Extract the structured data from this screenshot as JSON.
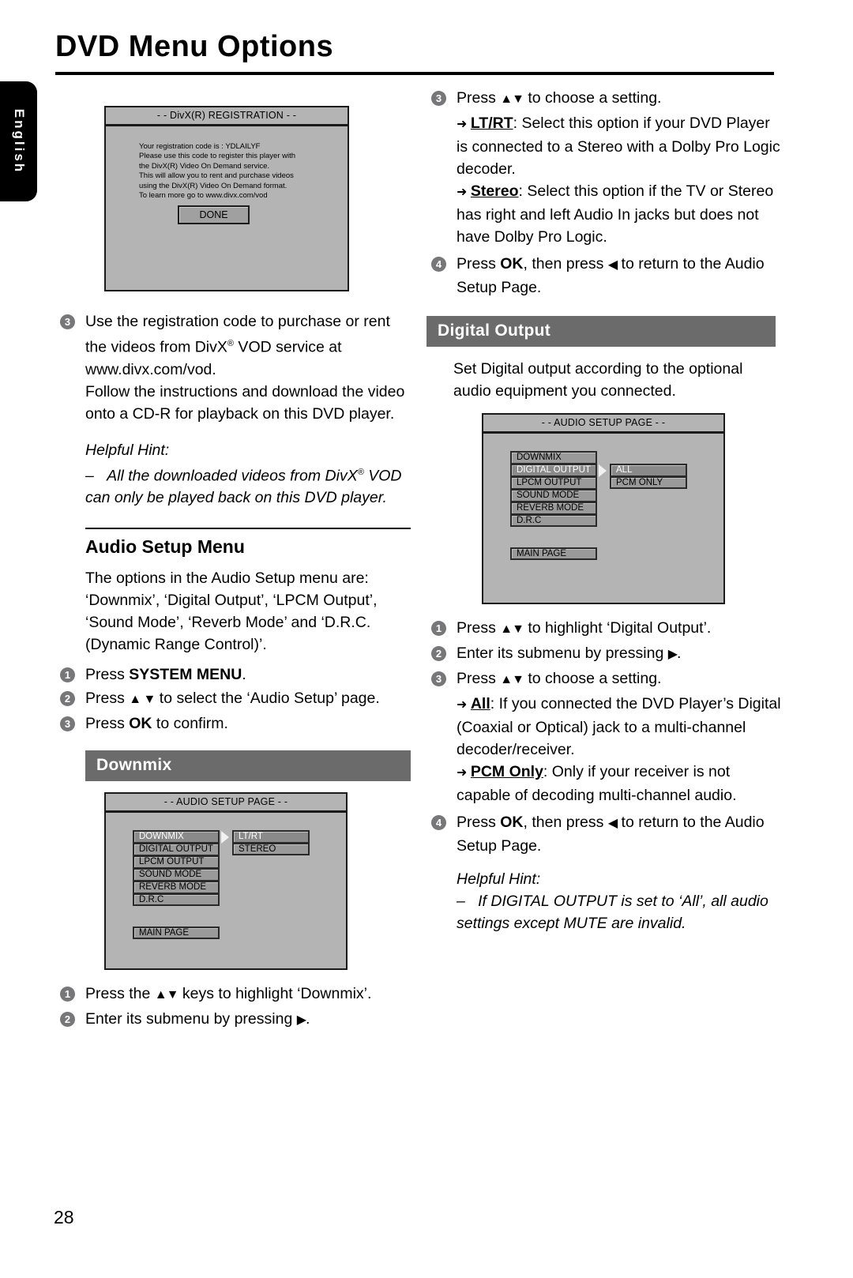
{
  "document": {
    "title": "DVD Menu Options",
    "page_number": "28",
    "language_tab": "English"
  },
  "left_column": {
    "divx_screen": {
      "title": "- - DivX(R) REGISTRATION - -",
      "lines": [
        "Your registration code is : YDLAILYF",
        "Please use this code to register this player with",
        "the DivX(R) Video On Demand service.",
        "This will allow you to rent and purchase videos",
        "using the DivX(R) Video On Demand format.",
        "To learn more go to www.divx.com/vod"
      ],
      "button": "DONE"
    },
    "step3": {
      "num": "3",
      "text_a": "Use the registration code to purchase or rent the videos from DivX",
      "reg": "®",
      "text_b": " VOD service at www.divx.com/vod.",
      "text_c": "Follow the instructions and download the video onto a CD-R for playback on this DVD player."
    },
    "hint": {
      "label": "Helpful Hint:",
      "dash": "–",
      "text_a": "All the downloaded videos from DivX",
      "reg": "®",
      "text_b": " VOD can only be played back on this DVD player."
    },
    "audio_setup_menu": {
      "heading": "Audio Setup Menu",
      "intro": "The options in the Audio Setup menu are: ‘Downmix’, ‘Digital Output’, ‘LPCM Output’, ‘Sound Mode’, ‘Reverb Mode’ and ‘D.R.C. (Dynamic Range Control)’.",
      "steps": [
        {
          "num": "1",
          "pre": "Press ",
          "bold": "SYSTEM MENU",
          "post": "."
        },
        {
          "num": "2",
          "pre": "Press ",
          "glyph": "▲ ▼",
          "post": " to select the ‘Audio Setup’ page."
        },
        {
          "num": "3",
          "pre": "Press ",
          "bold": "OK",
          "post": " to confirm."
        }
      ]
    },
    "downmix": {
      "bar_label": "Downmix",
      "screen": {
        "title": "- - AUDIO SETUP PAGE - -",
        "menu_items": [
          "DOWNMIX",
          "DIGITAL OUTPUT",
          "LPCM OUTPUT",
          "SOUND MODE",
          "REVERB MODE",
          "D.R.C"
        ],
        "selected_index": 0,
        "main_page": "MAIN PAGE",
        "submenu": [
          "LT/RT",
          "STEREO"
        ],
        "submenu_selected_index": 0
      },
      "steps": [
        {
          "num": "1",
          "pre": "Press the ",
          "glyph": "▲▼",
          "post": " keys to highlight ‘Downmix’."
        },
        {
          "num": "2",
          "pre": "Enter its submenu by pressing ",
          "glyph": "▶",
          "post": "."
        }
      ]
    }
  },
  "right_column": {
    "downmix_continued": {
      "step3": {
        "num": "3",
        "pre": "Press ",
        "glyph": "▲▼",
        "post": " to choose a setting."
      },
      "bullets": [
        {
          "arrow": "➜",
          "term": "LT/RT",
          "text": ": Select this option if your DVD Player is connected to a Stereo with a Dolby Pro Logic decoder."
        },
        {
          "arrow": "➜",
          "term": "Stereo",
          "text": ": Select this option if the TV or Stereo has right and left Audio In jacks but does not have Dolby Pro Logic."
        }
      ],
      "step4": {
        "num": "4",
        "pre": "Press ",
        "bold": "OK",
        "mid": ", then press ",
        "glyph": "◀",
        "post": " to return to the Audio Setup Page."
      }
    },
    "digital_output": {
      "bar_label": "Digital Output",
      "intro": "Set Digital output according to the optional audio equipment you connected.",
      "screen": {
        "title": "- - AUDIO SETUP PAGE - -",
        "menu_items": [
          "DOWNMIX",
          "DIGITAL OUTPUT",
          "LPCM OUTPUT",
          "SOUND MODE",
          "REVERB MODE",
          "D.R.C"
        ],
        "selected_index": 1,
        "main_page": "MAIN PAGE",
        "submenu": [
          "ALL",
          "PCM ONLY"
        ],
        "submenu_selected_index": 0
      },
      "steps": [
        {
          "num": "1",
          "pre": "Press ",
          "glyph": "▲▼",
          "post": " to highlight ‘Digital Output’."
        },
        {
          "num": "2",
          "pre": "Enter its submenu by pressing ",
          "glyph": "▶",
          "post": "."
        },
        {
          "num": "3",
          "pre": "Press ",
          "glyph": "▲▼",
          "post": " to choose a setting."
        }
      ],
      "bullets": [
        {
          "arrow": "➜",
          "term": "All",
          "text": ": If you connected the DVD Player’s Digital (Coaxial or Optical) jack to a multi-channel decoder/receiver."
        },
        {
          "arrow": "➜",
          "term": "PCM Only",
          "text": ": Only if your receiver is not capable of decoding multi-channel audio."
        }
      ],
      "step4": {
        "num": "4",
        "pre": "Press ",
        "bold": "OK",
        "mid": ", then press ",
        "glyph": "◀",
        "post": " to return to the Audio Setup Page."
      },
      "hint": {
        "label": "Helpful Hint:",
        "dash": "–",
        "text": "If DIGITAL OUTPUT is set to ‘All’, all audio settings except MUTE are invalid."
      }
    }
  },
  "colors": {
    "section_bar": "#6b6b6b",
    "step_badge": "#77777a",
    "screen_bg": "#b4b4b4",
    "menu_item": "#9a9a9a",
    "menu_selected": "#8a8a8a"
  }
}
